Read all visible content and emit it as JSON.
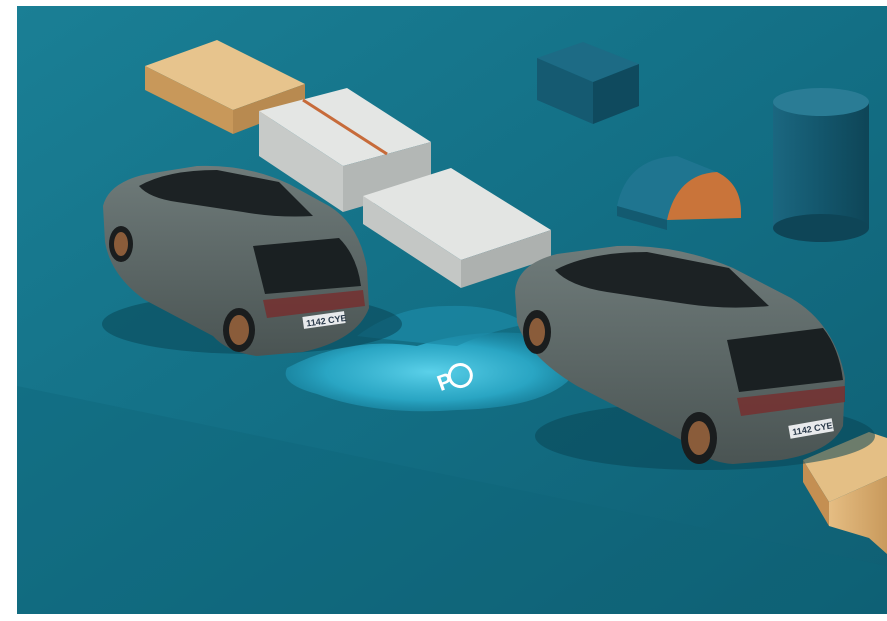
{
  "scene": {
    "description_label": "Parking assist illustration",
    "park_assist_symbol": "P",
    "car_left": {
      "plate": "1142 CYE"
    },
    "car_right": {
      "plate": "1142 CYE"
    },
    "colors": {
      "floor": "#136f85",
      "floor_dark": "#0e5a6d",
      "glow": "#37c2e0",
      "car_body": "#5c6766",
      "wood": "#d8ad6e",
      "concrete": "#d7d9d7",
      "blocks": "#14607a",
      "copper": "#c9743a"
    }
  }
}
